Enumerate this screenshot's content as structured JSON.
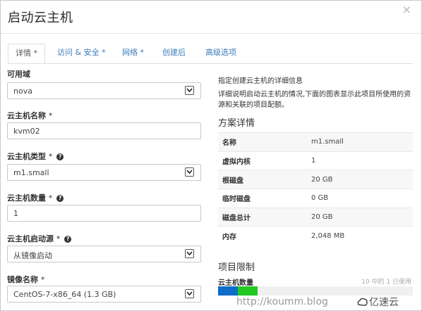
{
  "modal": {
    "title": "启动云主机",
    "close_glyph": "×"
  },
  "tabs": [
    {
      "label": "详情 *",
      "active": true
    },
    {
      "label": "访问 & 安全 *",
      "active": false
    },
    {
      "label": "网络 *",
      "active": false
    },
    {
      "label": "创建后",
      "active": false
    },
    {
      "label": "高级选项",
      "active": false
    }
  ],
  "form": {
    "availability_zone": {
      "label": "可用域",
      "value": "nova"
    },
    "instance_name": {
      "label": "云主机名称",
      "required_mark": "*",
      "value": "kvm02"
    },
    "flavor": {
      "label": "云主机类型",
      "required_mark": "*",
      "value": "m1.small",
      "help_icon": "question-circle-icon"
    },
    "count": {
      "label": "云主机数量",
      "required_mark": "*",
      "value": "1",
      "help_icon": "question-circle-icon"
    },
    "boot_source": {
      "label": "云主机启动源",
      "required_mark": "*",
      "value": "从镜像启动",
      "help_icon": "question-circle-icon"
    },
    "image": {
      "label": "镜像名称",
      "required_mark": "*",
      "value": "CentOS-7-x86_64 (1.3 GB)"
    }
  },
  "help": {
    "line1": "指定创建云主机的详细信息",
    "line2": "详细说明启动云主机的情况,下面的图表显示此项目所使用的资源和关联的项目配额。"
  },
  "flavor_details": {
    "heading": "方案详情",
    "rows": [
      {
        "key": "名称",
        "value": "m1.small"
      },
      {
        "key": "虚拟内核",
        "value": "1"
      },
      {
        "key": "根磁盘",
        "value": "20 GB"
      },
      {
        "key": "临时磁盘",
        "value": "0 GB"
      },
      {
        "key": "磁盘总计",
        "value": "20 GB"
      },
      {
        "key": "内存",
        "value": "2,048 MB"
      }
    ]
  },
  "quota": {
    "heading": "项目限制",
    "label": "云主机数量",
    "usage_text": "10 中的 1 已使用",
    "used": 1,
    "added": 1,
    "limit": 10,
    "used_color": "#0f6dca",
    "added_color": "#21c921"
  },
  "watermark": {
    "text": "http://koumm.blog",
    "logo_text": "亿速云",
    "logo_icon": "yisu-cloud-logo"
  }
}
